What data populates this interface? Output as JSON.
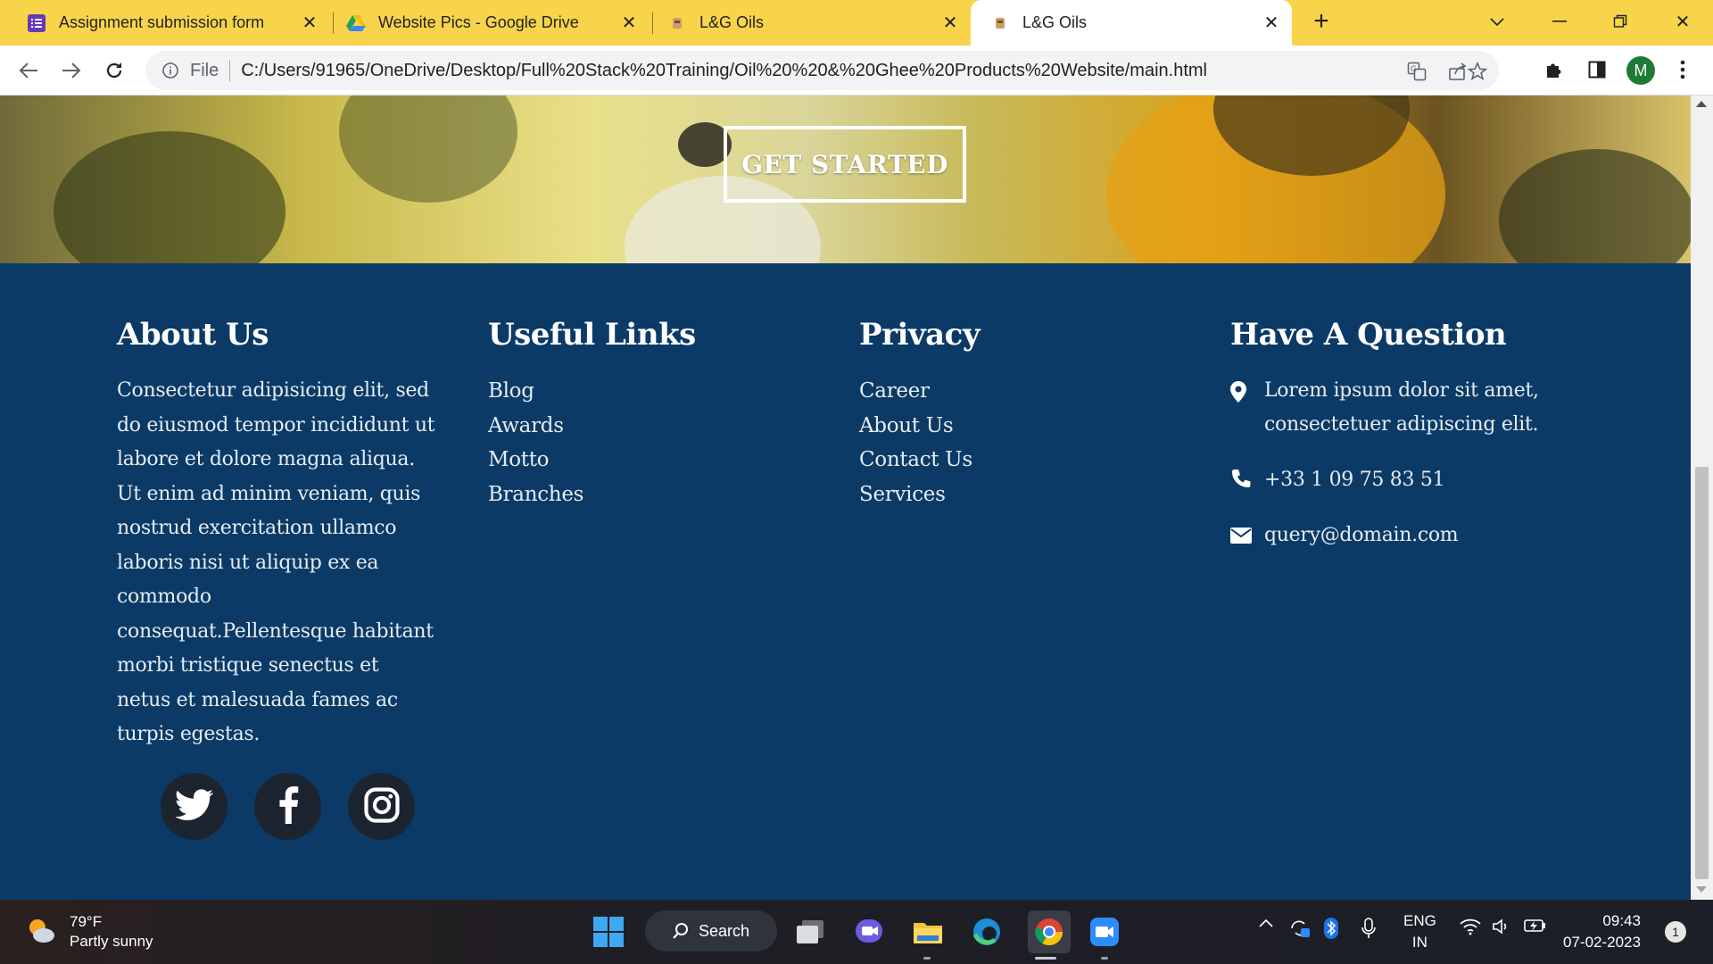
{
  "browser": {
    "tabs": [
      {
        "title": "Assignment submission form",
        "icon": "forms-icon"
      },
      {
        "title": "Website Pics - Google Drive",
        "icon": "google-drive-icon"
      },
      {
        "title": "L&G Oils",
        "icon": "site-favicon"
      },
      {
        "title": "L&G Oils",
        "icon": "site-favicon",
        "active": true
      }
    ],
    "omnibox": {
      "scheme_label": "File",
      "url": "C:/Users/91965/OneDrive/Desktop/Full%20Stack%20Training/Oil%20%20&%20Ghee%20Products%20Website/main.html"
    },
    "profile_initial": "M"
  },
  "page": {
    "hero": {
      "cta_label": "GET STARTED"
    },
    "footer": {
      "about": {
        "heading": "About Us",
        "text": "Consectetur adipisicing elit, sed do eiusmod tempor incididunt ut labore et dolore magna aliqua. Ut enim ad minim veniam, quis nostrud exercitation ullamco laboris nisi ut aliquip ex ea commodo consequat.Pellentesque habitant morbi tristique senectus et netus et malesuada fames ac turpis egestas."
      },
      "useful_links": {
        "heading": "Useful Links",
        "items": [
          "Blog",
          "Awards",
          "Motto",
          "Branches"
        ]
      },
      "privacy": {
        "heading": "Privacy",
        "items": [
          "Career",
          "About Us",
          "Contact Us",
          "Services"
        ]
      },
      "question": {
        "heading": "Have A Question",
        "address": "Lorem ipsum dolor sit amet, consectetuer adipiscing elit.",
        "phone": "+33 1 09 75 83 51",
        "email": "query@domain.com"
      },
      "socials": [
        "twitter-icon",
        "facebook-icon",
        "instagram-icon"
      ]
    }
  },
  "taskbar": {
    "weather": {
      "temp": "79°F",
      "condition": "Partly sunny"
    },
    "search_label": "Search",
    "lang": {
      "line1": "ENG",
      "line2": "IN"
    },
    "clock": {
      "time": "09:43",
      "date": "07-02-2023"
    },
    "notifications": "1"
  }
}
